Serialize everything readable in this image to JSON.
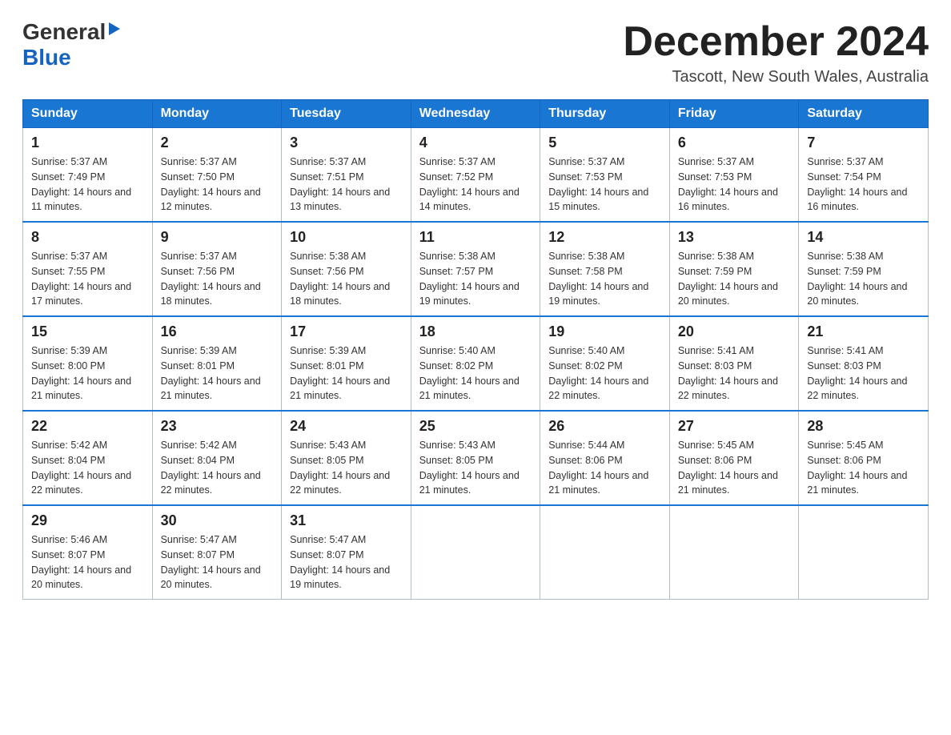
{
  "header": {
    "logo_general": "General",
    "logo_blue": "Blue",
    "month_title": "December 2024",
    "location": "Tascott, New South Wales, Australia"
  },
  "calendar": {
    "days_of_week": [
      "Sunday",
      "Monday",
      "Tuesday",
      "Wednesday",
      "Thursday",
      "Friday",
      "Saturday"
    ],
    "weeks": [
      [
        {
          "day": "1",
          "sunrise": "Sunrise: 5:37 AM",
          "sunset": "Sunset: 7:49 PM",
          "daylight": "Daylight: 14 hours and 11 minutes."
        },
        {
          "day": "2",
          "sunrise": "Sunrise: 5:37 AM",
          "sunset": "Sunset: 7:50 PM",
          "daylight": "Daylight: 14 hours and 12 minutes."
        },
        {
          "day": "3",
          "sunrise": "Sunrise: 5:37 AM",
          "sunset": "Sunset: 7:51 PM",
          "daylight": "Daylight: 14 hours and 13 minutes."
        },
        {
          "day": "4",
          "sunrise": "Sunrise: 5:37 AM",
          "sunset": "Sunset: 7:52 PM",
          "daylight": "Daylight: 14 hours and 14 minutes."
        },
        {
          "day": "5",
          "sunrise": "Sunrise: 5:37 AM",
          "sunset": "Sunset: 7:53 PM",
          "daylight": "Daylight: 14 hours and 15 minutes."
        },
        {
          "day": "6",
          "sunrise": "Sunrise: 5:37 AM",
          "sunset": "Sunset: 7:53 PM",
          "daylight": "Daylight: 14 hours and 16 minutes."
        },
        {
          "day": "7",
          "sunrise": "Sunrise: 5:37 AM",
          "sunset": "Sunset: 7:54 PM",
          "daylight": "Daylight: 14 hours and 16 minutes."
        }
      ],
      [
        {
          "day": "8",
          "sunrise": "Sunrise: 5:37 AM",
          "sunset": "Sunset: 7:55 PM",
          "daylight": "Daylight: 14 hours and 17 minutes."
        },
        {
          "day": "9",
          "sunrise": "Sunrise: 5:37 AM",
          "sunset": "Sunset: 7:56 PM",
          "daylight": "Daylight: 14 hours and 18 minutes."
        },
        {
          "day": "10",
          "sunrise": "Sunrise: 5:38 AM",
          "sunset": "Sunset: 7:56 PM",
          "daylight": "Daylight: 14 hours and 18 minutes."
        },
        {
          "day": "11",
          "sunrise": "Sunrise: 5:38 AM",
          "sunset": "Sunset: 7:57 PM",
          "daylight": "Daylight: 14 hours and 19 minutes."
        },
        {
          "day": "12",
          "sunrise": "Sunrise: 5:38 AM",
          "sunset": "Sunset: 7:58 PM",
          "daylight": "Daylight: 14 hours and 19 minutes."
        },
        {
          "day": "13",
          "sunrise": "Sunrise: 5:38 AM",
          "sunset": "Sunset: 7:59 PM",
          "daylight": "Daylight: 14 hours and 20 minutes."
        },
        {
          "day": "14",
          "sunrise": "Sunrise: 5:38 AM",
          "sunset": "Sunset: 7:59 PM",
          "daylight": "Daylight: 14 hours and 20 minutes."
        }
      ],
      [
        {
          "day": "15",
          "sunrise": "Sunrise: 5:39 AM",
          "sunset": "Sunset: 8:00 PM",
          "daylight": "Daylight: 14 hours and 21 minutes."
        },
        {
          "day": "16",
          "sunrise": "Sunrise: 5:39 AM",
          "sunset": "Sunset: 8:01 PM",
          "daylight": "Daylight: 14 hours and 21 minutes."
        },
        {
          "day": "17",
          "sunrise": "Sunrise: 5:39 AM",
          "sunset": "Sunset: 8:01 PM",
          "daylight": "Daylight: 14 hours and 21 minutes."
        },
        {
          "day": "18",
          "sunrise": "Sunrise: 5:40 AM",
          "sunset": "Sunset: 8:02 PM",
          "daylight": "Daylight: 14 hours and 21 minutes."
        },
        {
          "day": "19",
          "sunrise": "Sunrise: 5:40 AM",
          "sunset": "Sunset: 8:02 PM",
          "daylight": "Daylight: 14 hours and 22 minutes."
        },
        {
          "day": "20",
          "sunrise": "Sunrise: 5:41 AM",
          "sunset": "Sunset: 8:03 PM",
          "daylight": "Daylight: 14 hours and 22 minutes."
        },
        {
          "day": "21",
          "sunrise": "Sunrise: 5:41 AM",
          "sunset": "Sunset: 8:03 PM",
          "daylight": "Daylight: 14 hours and 22 minutes."
        }
      ],
      [
        {
          "day": "22",
          "sunrise": "Sunrise: 5:42 AM",
          "sunset": "Sunset: 8:04 PM",
          "daylight": "Daylight: 14 hours and 22 minutes."
        },
        {
          "day": "23",
          "sunrise": "Sunrise: 5:42 AM",
          "sunset": "Sunset: 8:04 PM",
          "daylight": "Daylight: 14 hours and 22 minutes."
        },
        {
          "day": "24",
          "sunrise": "Sunrise: 5:43 AM",
          "sunset": "Sunset: 8:05 PM",
          "daylight": "Daylight: 14 hours and 22 minutes."
        },
        {
          "day": "25",
          "sunrise": "Sunrise: 5:43 AM",
          "sunset": "Sunset: 8:05 PM",
          "daylight": "Daylight: 14 hours and 21 minutes."
        },
        {
          "day": "26",
          "sunrise": "Sunrise: 5:44 AM",
          "sunset": "Sunset: 8:06 PM",
          "daylight": "Daylight: 14 hours and 21 minutes."
        },
        {
          "day": "27",
          "sunrise": "Sunrise: 5:45 AM",
          "sunset": "Sunset: 8:06 PM",
          "daylight": "Daylight: 14 hours and 21 minutes."
        },
        {
          "day": "28",
          "sunrise": "Sunrise: 5:45 AM",
          "sunset": "Sunset: 8:06 PM",
          "daylight": "Daylight: 14 hours and 21 minutes."
        }
      ],
      [
        {
          "day": "29",
          "sunrise": "Sunrise: 5:46 AM",
          "sunset": "Sunset: 8:07 PM",
          "daylight": "Daylight: 14 hours and 20 minutes."
        },
        {
          "day": "30",
          "sunrise": "Sunrise: 5:47 AM",
          "sunset": "Sunset: 8:07 PM",
          "daylight": "Daylight: 14 hours and 20 minutes."
        },
        {
          "day": "31",
          "sunrise": "Sunrise: 5:47 AM",
          "sunset": "Sunset: 8:07 PM",
          "daylight": "Daylight: 14 hours and 19 minutes."
        },
        {
          "day": "",
          "sunrise": "",
          "sunset": "",
          "daylight": ""
        },
        {
          "day": "",
          "sunrise": "",
          "sunset": "",
          "daylight": ""
        },
        {
          "day": "",
          "sunrise": "",
          "sunset": "",
          "daylight": ""
        },
        {
          "day": "",
          "sunrise": "",
          "sunset": "",
          "daylight": ""
        }
      ]
    ]
  }
}
